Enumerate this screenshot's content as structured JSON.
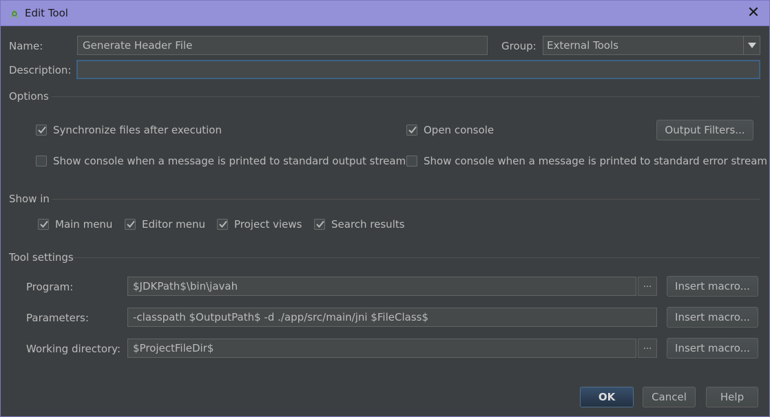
{
  "window": {
    "title": "Edit Tool",
    "close_symbol": "✕"
  },
  "form": {
    "name_label": "Name:",
    "name_value": "Generate Header File",
    "group_label": "Group:",
    "group_value": "External Tools",
    "description_label": "Description:",
    "description_value": ""
  },
  "options": {
    "section_title": "Options",
    "sync_files": {
      "label": "Synchronize files after execution",
      "checked": true
    },
    "open_console": {
      "label": "Open console",
      "checked": true
    },
    "output_filters_label": "Output Filters...",
    "show_console_stdout": {
      "label": "Show console when a message is printed to standard output stream",
      "checked": false
    },
    "show_console_stderr": {
      "label": "Show console when a message is printed to standard error stream",
      "checked": false
    }
  },
  "show_in": {
    "section_title": "Show in",
    "main_menu": {
      "label": "Main menu",
      "checked": true
    },
    "editor_menu": {
      "label": "Editor menu",
      "checked": true
    },
    "project_views": {
      "label": "Project views",
      "checked": true
    },
    "search_results": {
      "label": "Search results",
      "checked": true
    }
  },
  "tool_settings": {
    "section_title": "Tool settings",
    "program_label": "Program:",
    "program_value": "$JDKPath$\\bin\\javah",
    "parameters_label": "Parameters:",
    "parameters_value": "-classpath $OutputPath$ -d ./app/src/main/jni $FileClass$",
    "working_dir_label": "Working directory:",
    "working_dir_value": "$ProjectFileDir$",
    "insert_macro_label": "Insert macro...",
    "browse_label": "..."
  },
  "footer": {
    "ok_label": "OK",
    "cancel_label": "Cancel",
    "help_label": "Help"
  },
  "colors": {
    "titlebar": "#9491d9",
    "background": "#3c3f41",
    "field": "#45494a",
    "focus_border": "#3d6185",
    "primary_button": "#2f4258"
  }
}
